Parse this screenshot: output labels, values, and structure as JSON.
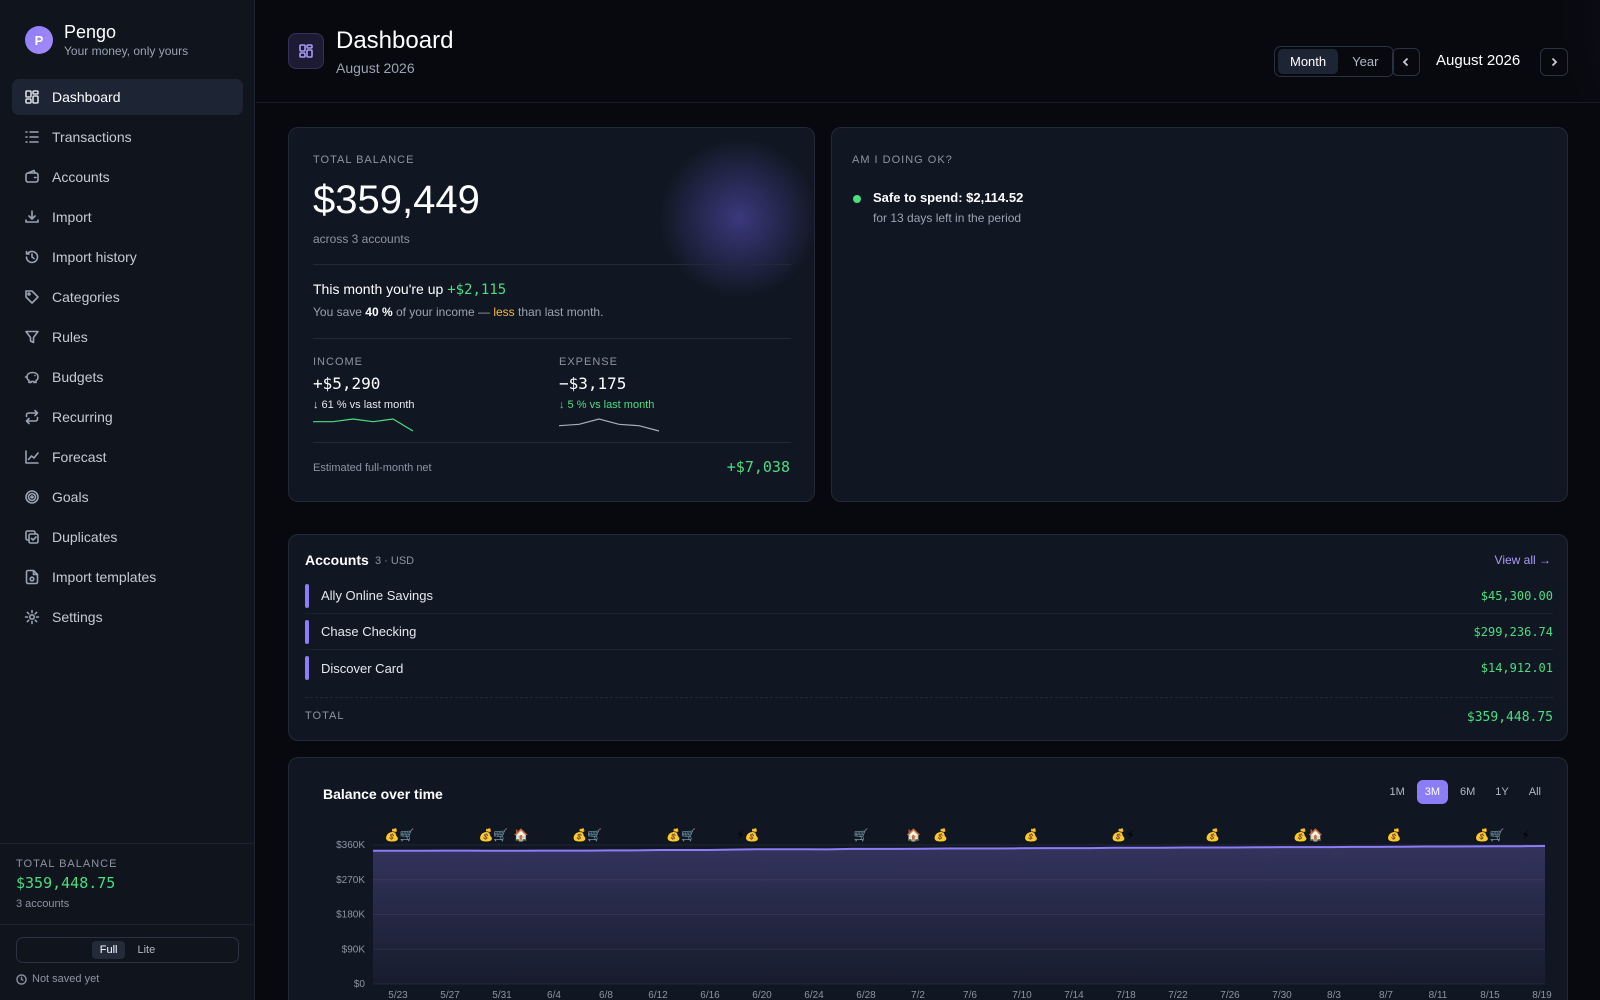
{
  "app": {
    "name": "Pengo",
    "tagline": "Your money, only yours",
    "logo_letter": "P"
  },
  "nav": [
    {
      "label": "Dashboard",
      "icon": "dashboard-icon",
      "active": true
    },
    {
      "label": "Transactions",
      "icon": "list-icon"
    },
    {
      "label": "Accounts",
      "icon": "wallet-icon"
    },
    {
      "label": "Import",
      "icon": "download-icon"
    },
    {
      "label": "Import history",
      "icon": "history-icon"
    },
    {
      "label": "Categories",
      "icon": "tag-icon"
    },
    {
      "label": "Rules",
      "icon": "filter-icon"
    },
    {
      "label": "Budgets",
      "icon": "piggy-bank-icon"
    },
    {
      "label": "Recurring",
      "icon": "repeat-icon"
    },
    {
      "label": "Forecast",
      "icon": "trend-icon"
    },
    {
      "label": "Goals",
      "icon": "target-icon"
    },
    {
      "label": "Duplicates",
      "icon": "copy-check-icon"
    },
    {
      "label": "Import templates",
      "icon": "file-template-icon"
    },
    {
      "label": "Settings",
      "icon": "gear-icon"
    }
  ],
  "sidebar_bottom": {
    "total_label": "TOTAL BALANCE",
    "total_value": "$359,448.75",
    "accounts": "3 accounts",
    "mode_full": "Full",
    "mode_lite": "Lite",
    "saved_status": "Not saved yet"
  },
  "header": {
    "title": "Dashboard",
    "subtitle": "August 2026",
    "seg_month": "Month",
    "seg_year": "Year",
    "period": "August 2026"
  },
  "balance_card": {
    "label": "TOTAL BALANCE",
    "value": "$359,449",
    "sub": "across 3 accounts",
    "up_prefix": "This month you're up ",
    "up_amount": "+$2,115",
    "save_prefix": "You save ",
    "save_pct": "40 %",
    "save_mid": " of your income — ",
    "save_less": "less",
    "save_suffix": " than last month.",
    "income_label": "INCOME",
    "income_value": "+$5,290",
    "income_change": "↓ 61 % vs last month",
    "income_spark": [
      3,
      3,
      5,
      3,
      5,
      -4
    ],
    "expense_label": "EXPENSE",
    "expense_value": "−$3,175",
    "expense_change": "↓ 5 % vs last month",
    "expense_spark": [
      0,
      1,
      5,
      1,
      0,
      -4
    ],
    "est_label": "Estimated full-month net",
    "est_value": "+$7,038"
  },
  "ok_card": {
    "label": "AM I DOING OK?",
    "status_title": "Safe to spend: $2,114.52",
    "status_sub": "for 13 days left in the period",
    "status_color": "#4ade80"
  },
  "accounts": {
    "title": "Accounts",
    "meta": "3 · USD",
    "view_all": "View all →",
    "rows": [
      {
        "name": "Ally Online Savings",
        "amount": "$45,300.00"
      },
      {
        "name": "Chase Checking",
        "amount": "$299,236.74"
      },
      {
        "name": "Discover Card",
        "amount": "$14,912.01"
      }
    ],
    "total_label": "TOTAL",
    "total_value": "$359,448.75"
  },
  "chart_data": {
    "type": "area",
    "title": "Balance over time",
    "ranges": [
      "1M",
      "3M",
      "6M",
      "1Y",
      "All"
    ],
    "active_range": "3M",
    "y_ticks": [
      "$0",
      "$90K",
      "$180K",
      "$270K",
      "$360K"
    ],
    "ylim": [
      0,
      360000
    ],
    "x_ticks": [
      "5/23",
      "5/27",
      "5/31",
      "6/4",
      "6/8",
      "6/12",
      "6/16",
      "6/20",
      "6/24",
      "6/28",
      "7/2",
      "7/6",
      "7/10",
      "7/14",
      "7/18",
      "7/22",
      "7/26",
      "7/30",
      "8/3",
      "8/7",
      "8/11",
      "8/15",
      "8/19"
    ],
    "series": [
      {
        "values": [
          345000,
          345000,
          345000,
          345500,
          345500,
          345000,
          345000,
          345500,
          345500,
          345500,
          346000,
          346000,
          347000,
          347000,
          347000,
          348000,
          349000,
          349000,
          349000,
          348500,
          350000,
          350000,
          350000,
          350500,
          351000,
          351000,
          351000,
          351500,
          352000,
          352000,
          352000,
          353000,
          353000,
          353000,
          353500,
          353500,
          353500,
          354000,
          354500,
          354500,
          354500,
          355000,
          355000,
          355500,
          356000,
          356000,
          356500,
          357000,
          357000,
          357500
        ]
      }
    ],
    "color": "#8b7df5",
    "grid": true,
    "event_markers": [
      {
        "pos": 0.01,
        "icons": "💰🛒"
      },
      {
        "pos": 0.09,
        "icons": "💰🛒"
      },
      {
        "pos": 0.12,
        "icons": "🏠"
      },
      {
        "pos": 0.17,
        "icons": "💰🛒"
      },
      {
        "pos": 0.25,
        "icons": "💰🛒"
      },
      {
        "pos": 0.31,
        "icons": "⚡💰"
      },
      {
        "pos": 0.41,
        "icons": "🛒"
      },
      {
        "pos": 0.455,
        "icons": "🏠"
      },
      {
        "pos": 0.478,
        "icons": "💰"
      },
      {
        "pos": 0.555,
        "icons": "💰"
      },
      {
        "pos": 0.63,
        "icons": "💰⚡"
      },
      {
        "pos": 0.71,
        "icons": "💰"
      },
      {
        "pos": 0.785,
        "icons": "💰🏠"
      },
      {
        "pos": 0.865,
        "icons": "💰"
      },
      {
        "pos": 0.94,
        "icons": "💰🛒"
      },
      {
        "pos": 0.98,
        "icons": "⚡"
      }
    ]
  }
}
